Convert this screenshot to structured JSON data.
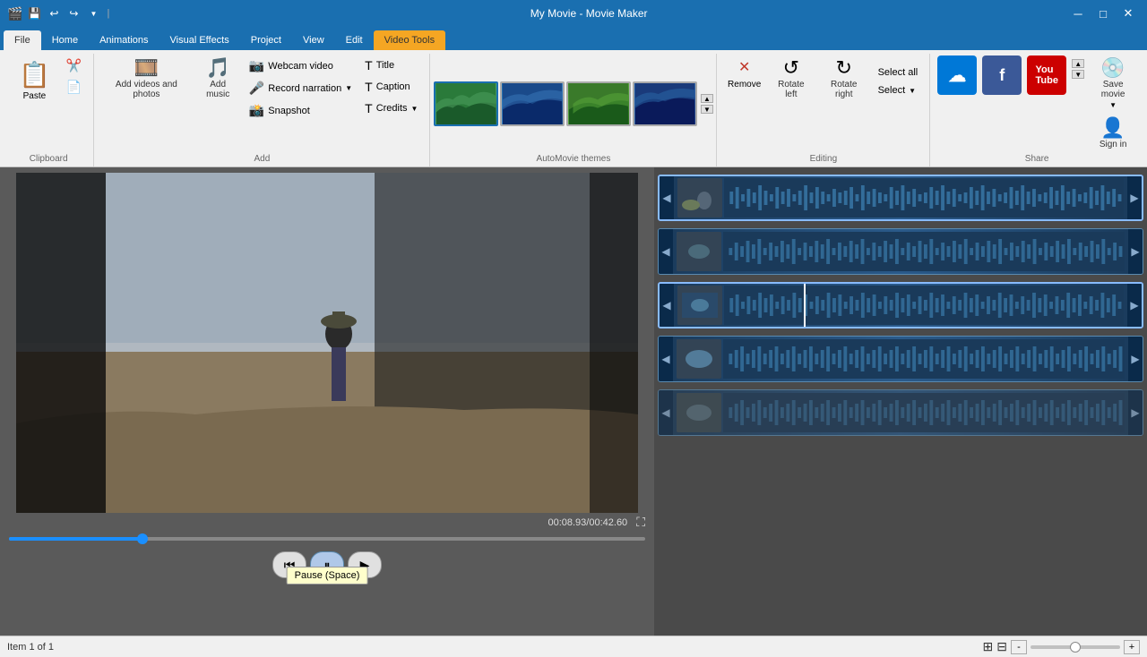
{
  "window": {
    "title": "My Movie - Movie Maker",
    "app_icon": "🎬"
  },
  "qat": {
    "buttons": [
      "💾",
      "↩",
      "↪",
      "▼"
    ]
  },
  "ribbon": {
    "tabs": [
      {
        "id": "file",
        "label": "File",
        "active": false
      },
      {
        "id": "home",
        "label": "Home",
        "active": true
      },
      {
        "id": "animations",
        "label": "Animations",
        "active": false
      },
      {
        "id": "visual-effects",
        "label": "Visual Effects",
        "active": false
      },
      {
        "id": "project",
        "label": "Project",
        "active": false
      },
      {
        "id": "view",
        "label": "View",
        "active": false
      },
      {
        "id": "edit",
        "label": "Edit",
        "active": false
      },
      {
        "id": "video-tools",
        "label": "Video Tools",
        "highlighted": true
      }
    ],
    "groups": {
      "clipboard": {
        "label": "Clipboard",
        "paste_label": "Paste",
        "cut_label": "Cut",
        "copy_label": "Copy"
      },
      "add": {
        "label": "Add",
        "add_videos_label": "Add videos\nand photos",
        "add_music_label": "Add\nmusic",
        "webcam_label": "Webcam video",
        "record_narration_label": "Record narration",
        "snapshot_label": "Snapshot",
        "title_label": "Title",
        "caption_label": "Caption",
        "credits_label": "Credits"
      },
      "automovie": {
        "label": "AutoMovie themes",
        "themes": [
          {
            "id": "theme1",
            "label": "Theme 1",
            "selected": true
          },
          {
            "id": "theme2",
            "label": "Theme 2",
            "selected": false
          },
          {
            "id": "theme3",
            "label": "Theme 3",
            "selected": false
          },
          {
            "id": "theme4",
            "label": "Theme 4",
            "selected": false
          }
        ]
      },
      "editing": {
        "label": "Editing",
        "remove_label": "Remove",
        "rotate_left_label": "Rotate left",
        "rotate_right_label": "Rotate right",
        "select_all_label": "Select all",
        "select_label": "Select"
      },
      "share": {
        "label": "Share",
        "skydrive_label": "SkyDrive",
        "facebook_label": "Facebook",
        "youtube_label": "YouTube",
        "save_movie_label": "Save\nmovie",
        "sign_in_label": "Sign\nin"
      }
    }
  },
  "preview": {
    "time_current": "00:08.93",
    "time_total": "00:42.60",
    "progress_pct": 21
  },
  "controls": {
    "rewind_label": "⏮",
    "pause_label": "⏸",
    "play_label": "▶",
    "tooltip": "Pause (Space)"
  },
  "timeline": {
    "tracks": [
      {
        "id": 1,
        "selected": true,
        "has_playhead": false
      },
      {
        "id": 2,
        "selected": false,
        "has_playhead": false
      },
      {
        "id": 3,
        "selected": true,
        "has_playhead": true
      },
      {
        "id": 4,
        "selected": false,
        "has_playhead": false
      },
      {
        "id": 5,
        "selected": false,
        "has_playhead": false
      }
    ]
  },
  "status_bar": {
    "item_info": "Item 1 of 1",
    "zoom_in": "+",
    "zoom_out": "-"
  }
}
